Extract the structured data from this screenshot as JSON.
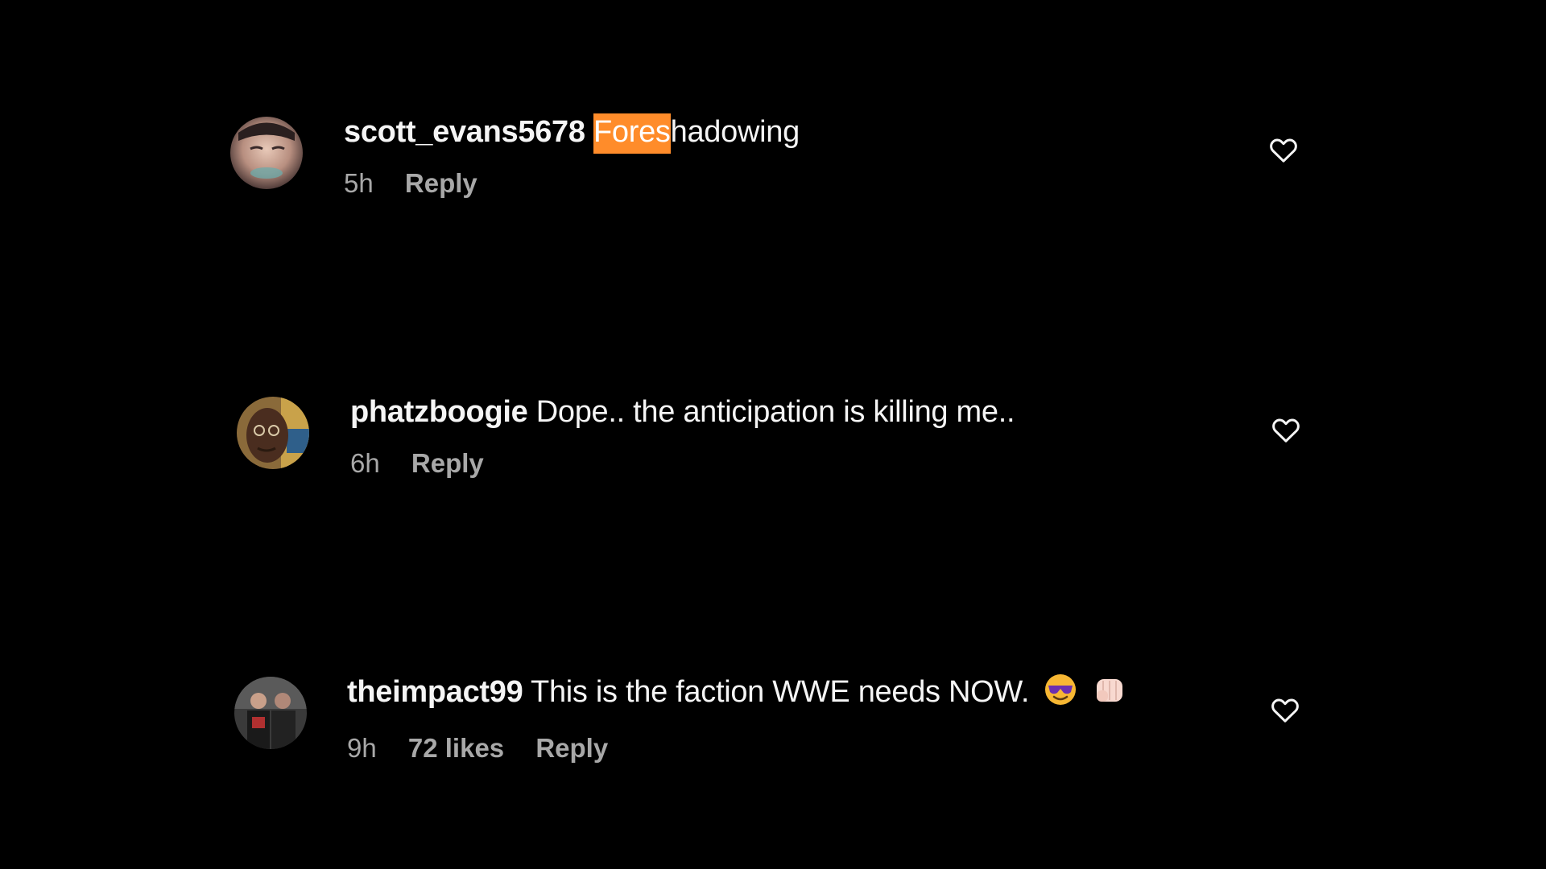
{
  "comments": [
    {
      "username": "scott_evans5678",
      "text_highlight": "Fores",
      "text_rest": "hadowing",
      "time": "5h",
      "likes": "",
      "reply_label": "Reply",
      "avatar": "user-avatar-photo",
      "like_icon": "heart-outline-icon"
    },
    {
      "username": "phatzboogie",
      "text": "Dope.. the anticipation is killing me..",
      "time": "6h",
      "likes": "",
      "reply_label": "Reply",
      "avatar": "user-avatar-photo",
      "like_icon": "heart-outline-icon"
    },
    {
      "username": "theimpact99",
      "text": "This is the faction WWE needs NOW.",
      "emojis": [
        "smiling-face-with-sunglasses-emoji",
        "oncoming-fist-emoji"
      ],
      "time": "9h",
      "likes": "72 likes",
      "reply_label": "Reply",
      "avatar": "user-avatar-photo",
      "like_icon": "heart-outline-icon"
    }
  ],
  "colors": {
    "background": "#000000",
    "text": "#f5f5f5",
    "meta": "#a8a8a8",
    "highlight": "#ff8c2a"
  }
}
